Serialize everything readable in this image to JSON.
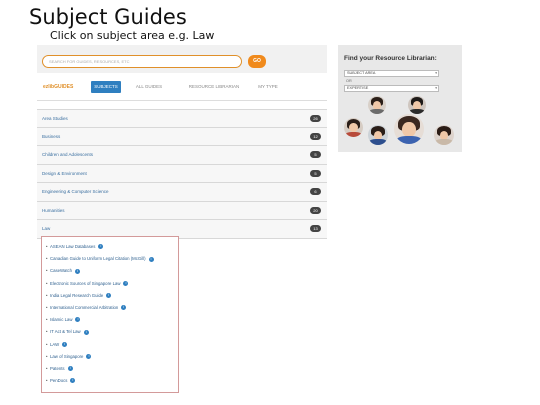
{
  "slide": {
    "title": "Subject Guides",
    "subtitle": "Click on subject area e.g. Law"
  },
  "search": {
    "placeholder": "SEARCH FOR GUIDES, RESOURCES, ETC",
    "go_label": "GO"
  },
  "nav": {
    "brand": "ezlibGUIDES",
    "tabs": [
      {
        "label": "SUBJECTS",
        "active": true
      },
      {
        "label": "ALL GUIDES",
        "active": false
      },
      {
        "label": "RESOURCE LIBRARIAN",
        "active": false
      },
      {
        "label": "MY TYPE",
        "active": false
      }
    ]
  },
  "subjects": [
    {
      "label": "Area Studies",
      "count": "26"
    },
    {
      "label": "Business",
      "count": "12"
    },
    {
      "label": "Children and Adolescents",
      "count": "5"
    },
    {
      "label": "Design & Environment",
      "count": "5"
    },
    {
      "label": "Engineering & Computer Science",
      "count": "6"
    },
    {
      "label": "Humanities",
      "count": "20"
    },
    {
      "label": "Law",
      "count": "13"
    }
  ],
  "law_guides": [
    "ASEAN Law Databases",
    "Canadian Guide to Uniform Legal Citation (McGill)",
    "CaseWatch",
    "Electronic Sources of Singapore Law",
    "India Legal Research Guide",
    "International Commercial Arbitration",
    "Islamic Law",
    "IT Act & Tel Law",
    "LAW",
    "Law of Singapore",
    "Patents",
    "PenDocs"
  ],
  "librarian": {
    "title": "Find your Resource Librarian:",
    "subject_select": "SUBJECT AREA",
    "or_label": "OR",
    "expertise_select": "EXPERTISE"
  },
  "colors": {
    "accent_orange": "#f08a1c",
    "tab_blue": "#2f7fc0",
    "highlight_border": "#d39a9a"
  }
}
